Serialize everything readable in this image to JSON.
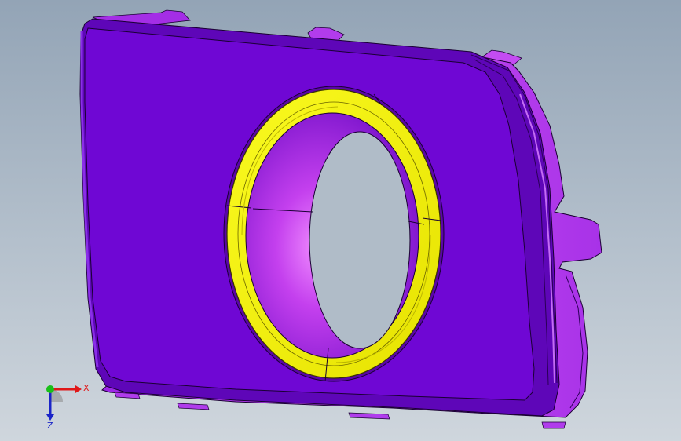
{
  "viewport": {
    "background_top": "#93a4b6",
    "background_bottom": "#cfd6dd"
  },
  "model": {
    "main_face_color": "#6f07d4",
    "edge_color": "#1a0033",
    "side_color": "#a22ee8",
    "bright_side_color": "#c94cf2",
    "ring_color": "#f2f20c",
    "ring_dark_color": "#b9b400"
  },
  "triad": {
    "x_label": "X",
    "z_label": "Z",
    "x_color": "#e01818",
    "y_color": "#19c019",
    "z_color": "#1a24c8"
  }
}
